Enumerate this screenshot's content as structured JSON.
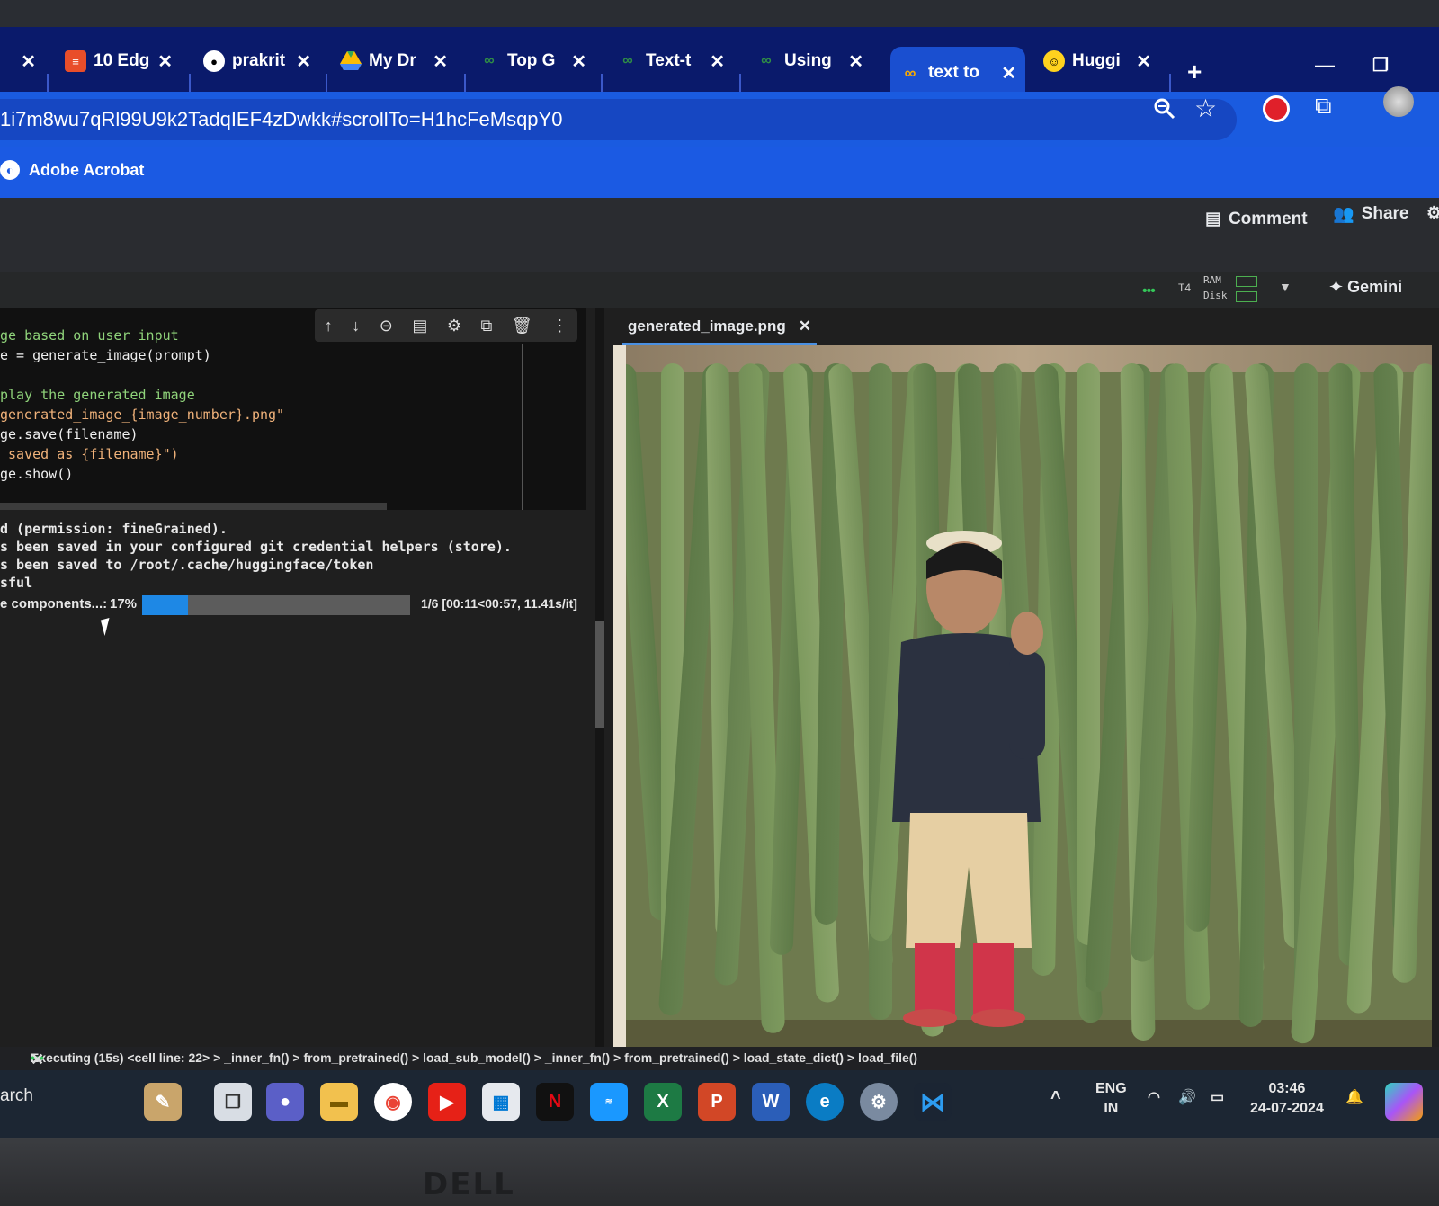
{
  "browser": {
    "tabs": [
      {
        "label": "10 Edg",
        "icon": "edge-favicon"
      },
      {
        "label": "prakrit",
        "icon": "github-icon"
      },
      {
        "label": "My Dr",
        "icon": "google-drive-icon"
      },
      {
        "label": "Top G",
        "icon": "geeksforgeeks-icon"
      },
      {
        "label": "Text-t",
        "icon": "geeksforgeeks-icon"
      },
      {
        "label": "Using",
        "icon": "geeksforgeeks-icon"
      },
      {
        "label": "text to",
        "icon": "colab-icon",
        "active": true
      },
      {
        "label": "Huggi",
        "icon": "huggingface-icon"
      }
    ],
    "url": "1i7m8wu7qRl99U9k2TadqIEF4zDwkk#scrollTo=H1hcFeMsqpY0",
    "bookmark": "Adobe Acrobat"
  },
  "colab": {
    "comment_label": "Comment",
    "share_label": "Share",
    "runtime_label": "T4",
    "ram_label": "RAM",
    "disk_label": "Disk",
    "gemini_label": "Gemini"
  },
  "code_lines": [
    {
      "text": "ge based on user input",
      "color": "green"
    },
    {
      "text": "e = generate_image(prompt)",
      "color": "white"
    },
    {
      "text": "",
      "color": "white"
    },
    {
      "text": "play the generated image",
      "color": "green"
    },
    {
      "text": "generated_image_{image_number}.png\"",
      "color": "orange"
    },
    {
      "text": "ge.save(filename)",
      "color": "white"
    },
    {
      "text": " saved as {filename}\")",
      "color": "orange"
    },
    {
      "text": "ge.show()",
      "color": "white"
    }
  ],
  "output_lines": [
    "d (permission: fineGrained).",
    "s been saved in your configured git credential helpers (store).",
    "s been saved to /root/.cache/huggingface/token",
    "sful"
  ],
  "progress": {
    "label": "e components...:",
    "percent_text": "17%",
    "fraction": 0.17,
    "stats": "1/6 [00:11<00:57, 11.41s/it]"
  },
  "file_viewer": {
    "filename": "generated_image.png"
  },
  "status_bar": {
    "text": "Executing (15s) <cell line: 22> > _inner_fn() > from_pretrained() > load_sub_model() > _inner_fn() > from_pretrained() > load_state_dict() > load_file()"
  },
  "taskbar": {
    "search_text": "arch",
    "lang_top": "ENG",
    "lang_bottom": "IN",
    "time": "03:46",
    "date": "24-07-2024"
  },
  "bezel": {
    "brand": "DELL"
  },
  "colors": {
    "tab_strip": "#0a1a6b",
    "accent_blue": "#1a5be0",
    "progress_fill": "#1e88e5"
  }
}
